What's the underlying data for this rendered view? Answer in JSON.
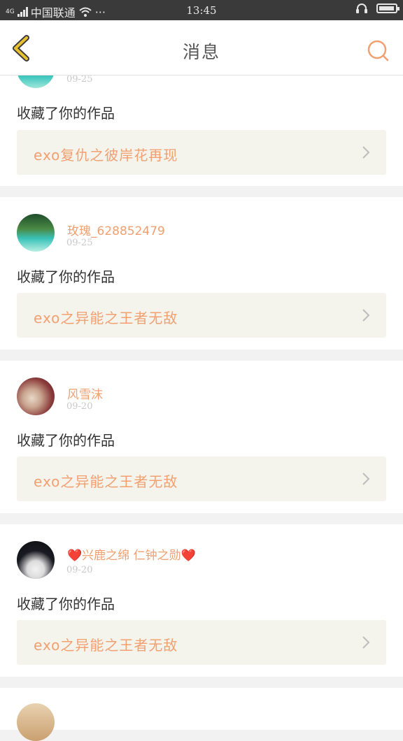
{
  "status_bar": {
    "network": "4G",
    "carrier": "中国联通",
    "more": "···",
    "time": "13:45"
  },
  "header": {
    "title": "消息"
  },
  "messages": [
    {
      "date": "09-25",
      "action": "收藏了你的作品",
      "work_title": "exo复仇之彼岸花再现"
    },
    {
      "username": "玫瑰_628852479",
      "date": "09-25",
      "action": "收藏了你的作品",
      "work_title": "exo之异能之王者无敌"
    },
    {
      "username": "风雪沫",
      "date": "09-20",
      "action": "收藏了你的作品",
      "work_title": "exo之异能之王者无敌"
    },
    {
      "username": "❤️兴鹿之绵 仁钟之勋❤️",
      "date": "09-20",
      "action": "收藏了你的作品",
      "work_title": "exo之异能之王者无敌"
    }
  ],
  "colors": {
    "accent": "#f0a070",
    "back_icon": "#e8c130",
    "background": "#f2f2f2"
  }
}
